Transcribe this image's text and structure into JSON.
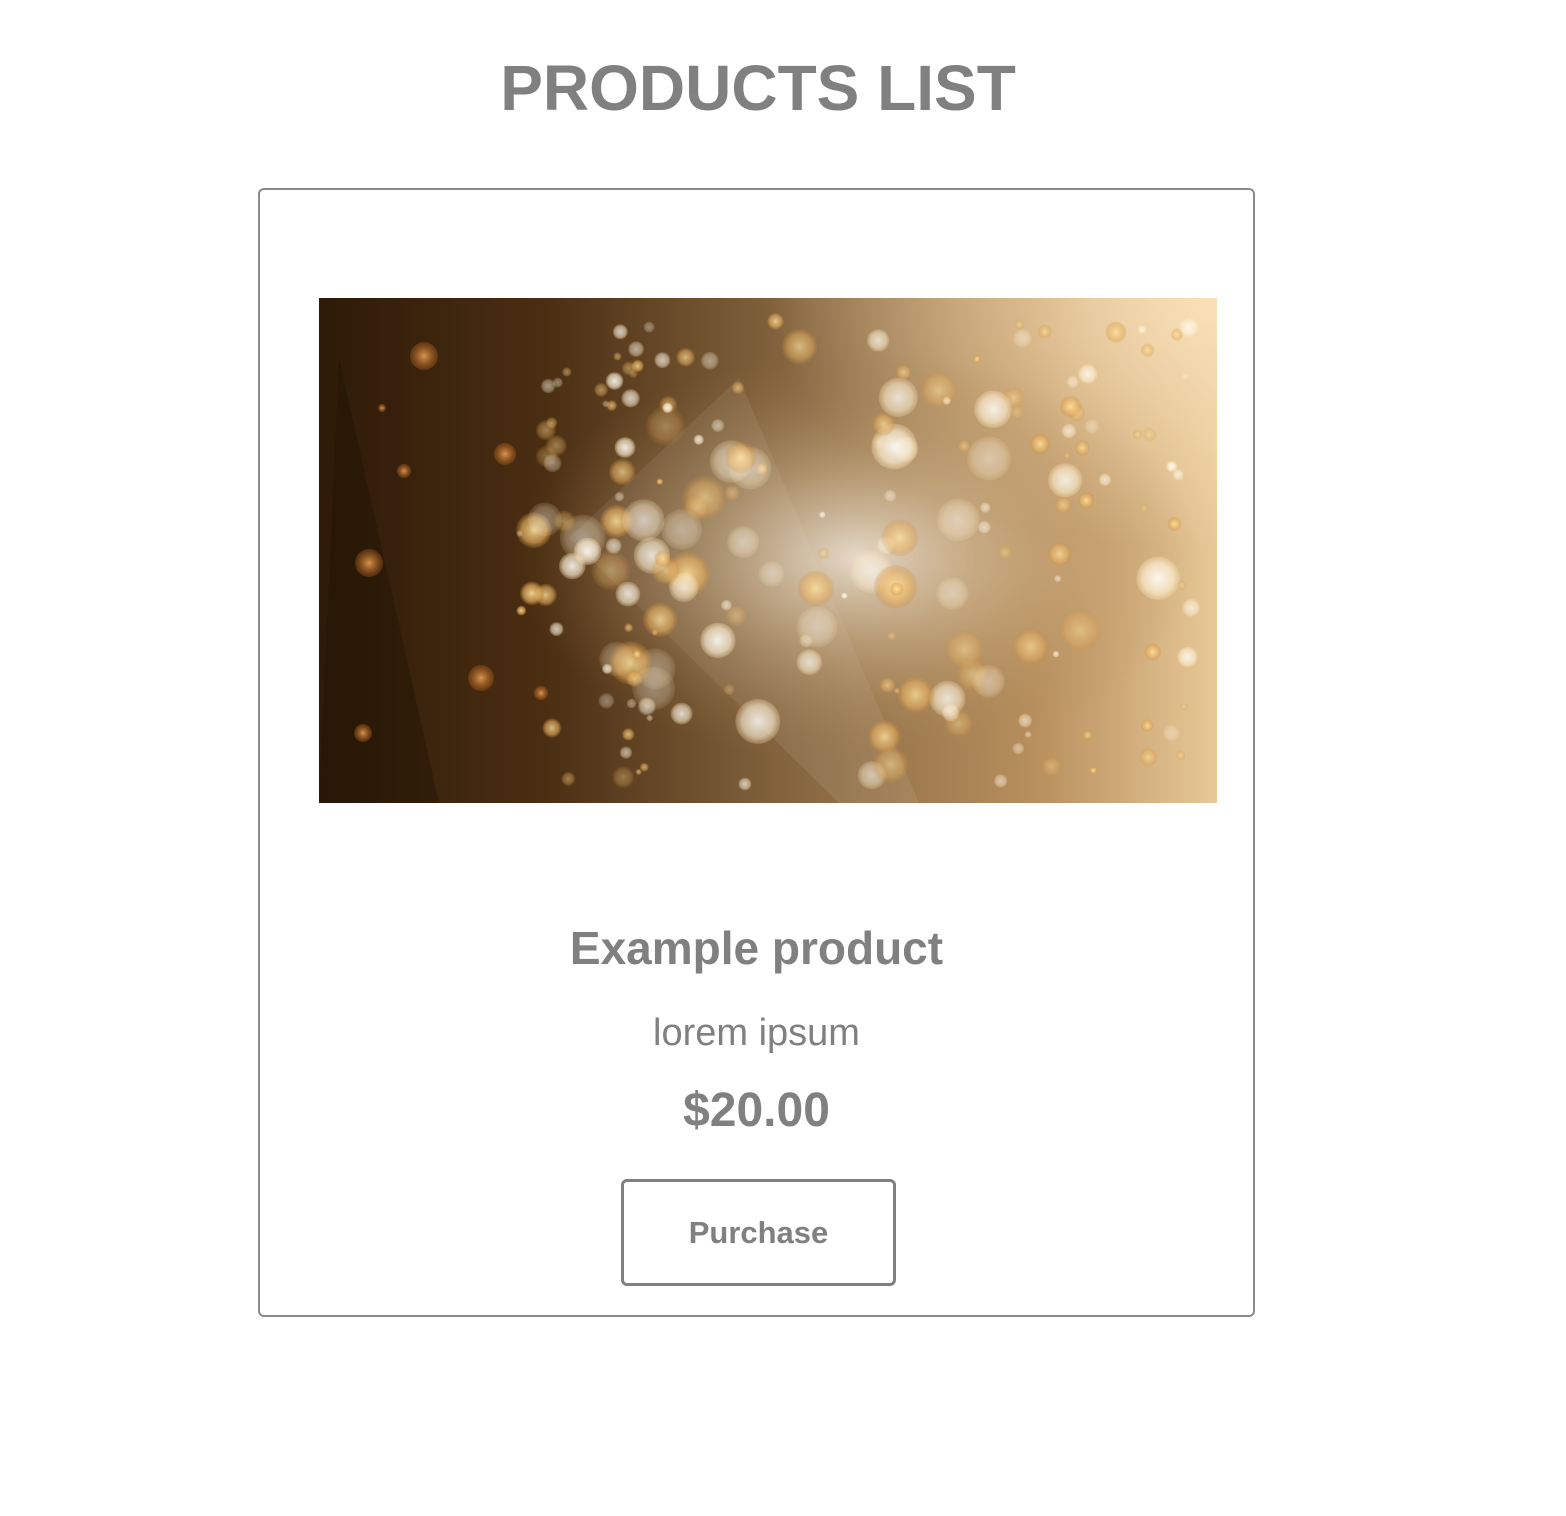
{
  "page": {
    "title": "PRODUCTS LIST"
  },
  "product": {
    "name": "Example product",
    "description": "lorem ipsum",
    "price": "$20.00",
    "purchase_label": "Purchase",
    "image": {
      "kind": "golden-bokeh-background"
    }
  },
  "colors": {
    "text": "#808080",
    "border": "#8a8a8a",
    "background": "#ffffff"
  }
}
